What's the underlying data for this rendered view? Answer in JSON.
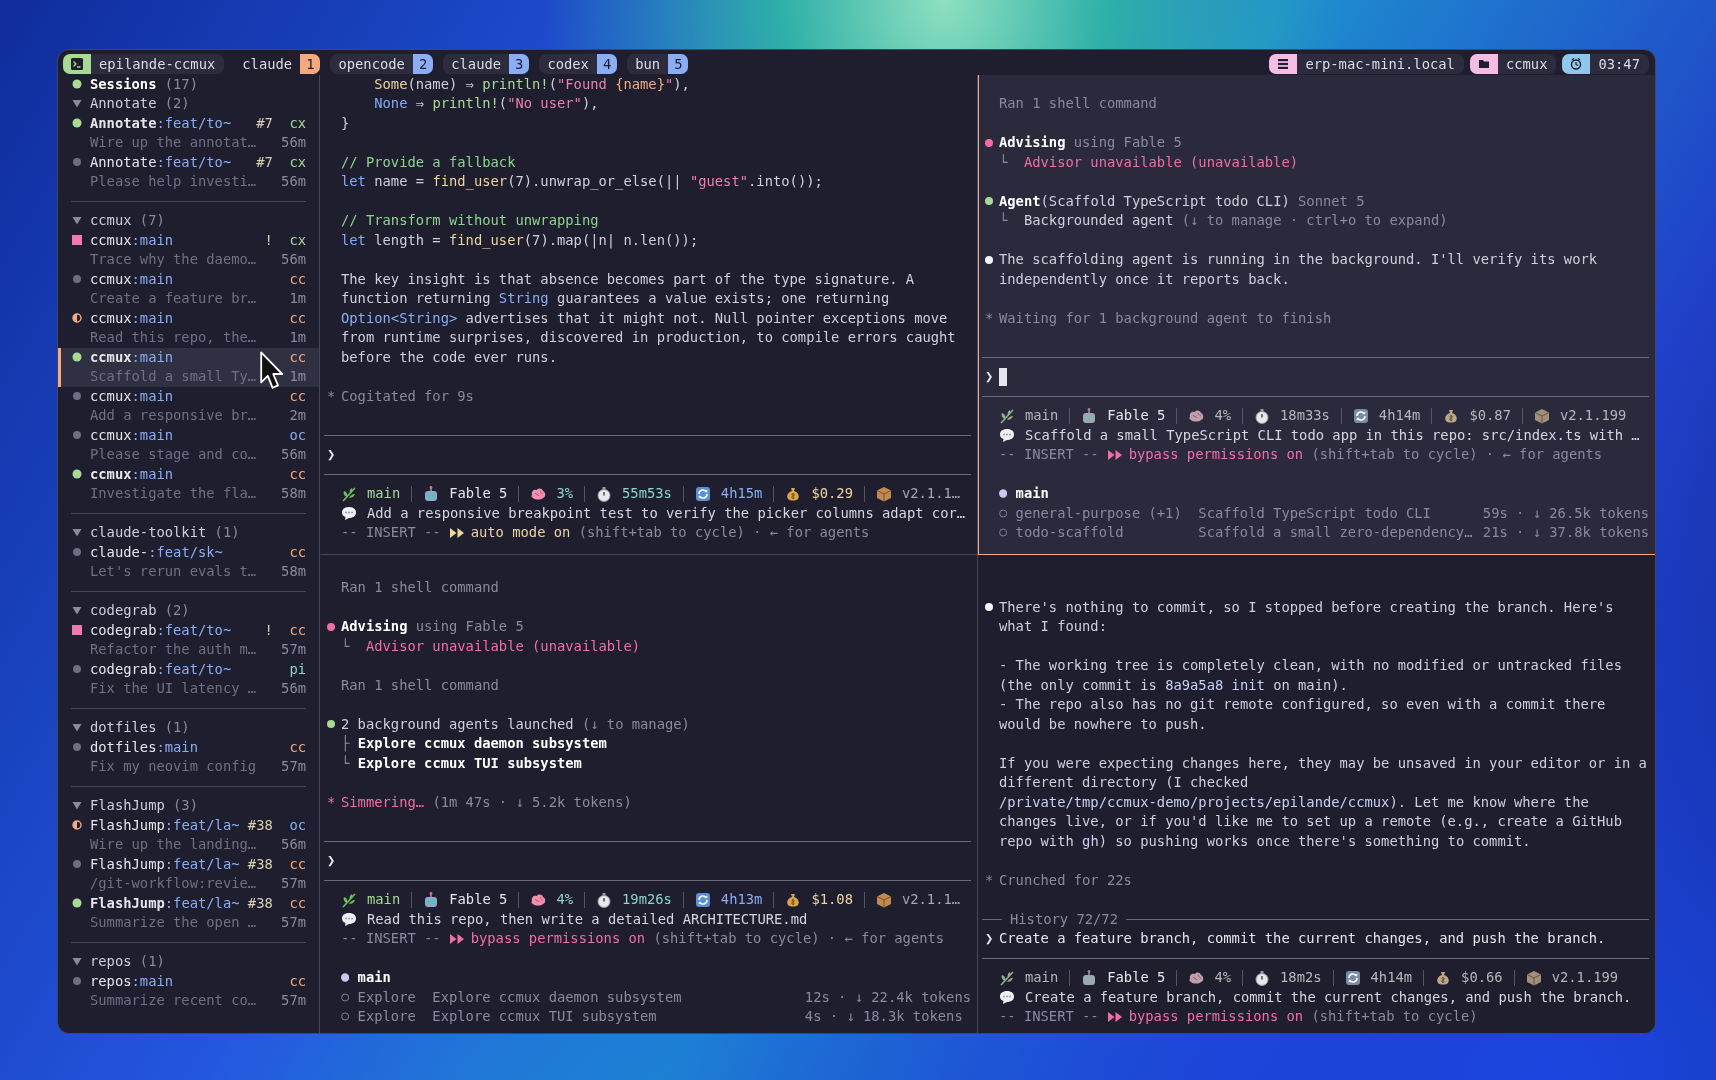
{
  "top_bar": {
    "session": {
      "label": "epilande-ccmux"
    },
    "windows": [
      {
        "name": "claude",
        "number": "1",
        "selected": true
      },
      {
        "name": "opencode",
        "number": "2",
        "selected": false
      },
      {
        "name": "claude",
        "number": "3",
        "selected": false
      },
      {
        "name": "codex",
        "number": "4",
        "selected": false
      },
      {
        "name": "bun",
        "number": "5",
        "selected": false
      }
    ],
    "indicators": [
      {
        "kind": "host",
        "label": "erp-mac-mini.local"
      },
      {
        "kind": "folder",
        "label": "ccmux"
      },
      {
        "kind": "clock",
        "label": "03:47"
      }
    ]
  },
  "sidebar": {
    "title": "Sessions",
    "count": "(17)",
    "groups": [
      {
        "name": "Annotate",
        "count": "(2)",
        "expanded": true,
        "sessions": [
          {
            "kind": "running",
            "repo": "Annotate",
            "branch": ":feat/to~",
            "flag": "#7",
            "agent": {
              "label": "cx",
              "color": "#a6da95"
            },
            "summary": "Wire up the annotat…",
            "age": "56m",
            "selected": false
          },
          {
            "kind": "idle",
            "repo": "Annotate",
            "branch": ":feat/to~",
            "flag": "#7",
            "agent": {
              "label": "cx",
              "color": "#a6da95"
            },
            "summary": "Please help investi…",
            "age": "56m",
            "selected": false
          }
        ]
      },
      {
        "name": "ccmux",
        "count": "(7)",
        "expanded": true,
        "sessions": [
          {
            "kind": "attention",
            "repo": "ccmux",
            "branch": ":main",
            "flag": "!",
            "agent": {
              "label": "cx",
              "color": "#a6da95"
            },
            "summary": "Trace why the daemo…",
            "age": "56m",
            "selected": false
          },
          {
            "kind": "idle",
            "repo": "ccmux",
            "branch": ":main",
            "agent": {
              "label": "cc",
              "color": "#f5a97f"
            },
            "summary": "Create a feature br…",
            "age": "1m",
            "selected": false
          },
          {
            "kind": "waiting",
            "repo": "ccmux",
            "branch": ":main",
            "agent": {
              "label": "cc",
              "color": "#f5a97f"
            },
            "summary": "Read this repo, the…",
            "age": "1m",
            "selected": false
          },
          {
            "kind": "running",
            "repo": "ccmux",
            "branch": ":main",
            "agent": {
              "label": "cc",
              "color": "#f5a97f"
            },
            "summary": "Scaffold a small Ty…",
            "age": "1m",
            "selected": true
          },
          {
            "kind": "idle",
            "repo": "ccmux",
            "branch": ":main",
            "agent": {
              "label": "cc",
              "color": "#f5a97f"
            },
            "summary": "Add a responsive br…",
            "age": "2m",
            "selected": false
          },
          {
            "kind": "idle",
            "repo": "ccmux",
            "branch": ":main",
            "agent": {
              "label": "oc",
              "color": "#8aadf4"
            },
            "summary": "Please stage and co…",
            "age": "56m",
            "selected": false
          },
          {
            "kind": "running",
            "repo": "ccmux",
            "branch": ":main",
            "agent": {
              "label": "cc",
              "color": "#f5a97f"
            },
            "summary": "Investigate the fla…",
            "age": "58m",
            "selected": false
          }
        ]
      },
      {
        "name": "claude-toolkit",
        "count": "(1)",
        "expanded": true,
        "sessions": [
          {
            "kind": "idle",
            "repo": "claude-",
            "branch": ":feat/sk~",
            "agent": {
              "label": "cc",
              "color": "#f5a97f"
            },
            "summary": "Let's rerun evals t…",
            "age": "58m",
            "selected": false
          }
        ]
      },
      {
        "name": "codegrab",
        "count": "(2)",
        "expanded": true,
        "sessions": [
          {
            "kind": "attention",
            "repo": "codegrab",
            "branch": ":feat/to~",
            "flag": "!",
            "agent": {
              "label": "cc",
              "color": "#f5a97f"
            },
            "summary": "Refactor the auth m…",
            "age": "57m",
            "selected": false
          },
          {
            "kind": "idle",
            "repo": "codegrab",
            "branch": ":feat/to~",
            "agent": {
              "label": "pi",
              "color": "#8bd5ca"
            },
            "summary": "Fix the UI latency …",
            "age": "56m",
            "selected": false
          }
        ]
      },
      {
        "name": "dotfiles",
        "count": "(1)",
        "expanded": true,
        "sessions": [
          {
            "kind": "idle",
            "repo": "dotfiles",
            "branch": ":main",
            "agent": {
              "label": "cc",
              "color": "#f5a97f"
            },
            "summary": "Fix my neovim config",
            "age": "57m",
            "selected": false
          }
        ]
      },
      {
        "name": "FlashJump",
        "count": "(3)",
        "expanded": true,
        "sessions": [
          {
            "kind": "waiting",
            "repo": "FlashJump",
            "branch": ":feat/la~",
            "flag": "#38",
            "agent": {
              "label": "oc",
              "color": "#8aadf4"
            },
            "summary": "Wire up the landing…",
            "age": "56m",
            "selected": false
          },
          {
            "kind": "idle",
            "repo": "FlashJump",
            "branch": ":feat/la~",
            "flag": "#38",
            "agent": {
              "label": "cc",
              "color": "#f5a97f"
            },
            "summary": "/git-workflow:revie…",
            "age": "57m",
            "selected": false
          },
          {
            "kind": "running",
            "repo": "FlashJump",
            "branch": ":feat/la~",
            "flag": "#38",
            "agent": {
              "label": "cc",
              "color": "#f5a97f"
            },
            "summary": "Summarize the open …",
            "age": "57m",
            "selected": false
          }
        ]
      },
      {
        "name": "repos",
        "count": "(1)",
        "expanded": true,
        "sessions": [
          {
            "kind": "idle",
            "repo": "repos",
            "branch": ":main",
            "agent": {
              "label": "cc",
              "color": "#f5a97f"
            },
            "summary": "Summarize recent co…",
            "age": "57m",
            "selected": false
          }
        ]
      }
    ]
  },
  "panes": [
    {
      "focused": false,
      "transcript": [
        {
          "kind": "code",
          "lines": [
            [
              {
                "text": "    Some",
                "kind": "accent"
              },
              {
                "text": "(name) ⇒ ",
                "kind": "plain"
              },
              {
                "text": "println!",
                "kind": "function"
              },
              {
                "text": "(",
                "kind": "plain"
              },
              {
                "text": "\"Found ",
                "kind": "string"
              },
              {
                "text": "{name}",
                "kind": "orange"
              },
              {
                "text": "\"",
                "kind": "string"
              },
              {
                "text": "),",
                "kind": "plain"
              }
            ],
            [
              {
                "text": "    None",
                "kind": "keyword"
              },
              {
                "text": " ⇒ ",
                "kind": "plain"
              },
              {
                "text": "println!",
                "kind": "function"
              },
              {
                "text": "(",
                "kind": "plain"
              },
              {
                "text": "\"No user\"",
                "kind": "string"
              },
              {
                "text": "),",
                "kind": "plain"
              }
            ],
            [
              {
                "text": "}",
                "kind": "plain"
              }
            ]
          ]
        },
        {
          "kind": "blank"
        },
        {
          "kind": "code",
          "lines": [
            [
              {
                "text": "// Provide a fallback",
                "kind": "comment"
              }
            ],
            [
              {
                "text": "let",
                "kind": "keyword"
              },
              {
                "text": " name = ",
                "kind": "plain"
              },
              {
                "text": "find_user",
                "kind": "accent"
              },
              {
                "text": "(7).unwrap_or_else(|| ",
                "kind": "plain"
              },
              {
                "text": "\"guest\"",
                "kind": "string"
              },
              {
                "text": ".into());",
                "kind": "plain"
              }
            ]
          ]
        },
        {
          "kind": "blank"
        },
        {
          "kind": "code",
          "lines": [
            [
              {
                "text": "// Transform without unwrapping",
                "kind": "comment"
              }
            ],
            [
              {
                "text": "let",
                "kind": "keyword"
              },
              {
                "text": " length = ",
                "kind": "plain"
              },
              {
                "text": "find_user",
                "kind": "accent"
              },
              {
                "text": "(7).map(|n| n.len());",
                "kind": "plain"
              }
            ]
          ]
        },
        {
          "kind": "blank"
        },
        {
          "kind": "para",
          "lines": [
            [
              {
                "text": "The key insight is that absence becomes part of the type signature. A",
                "kind": "plain"
              }
            ],
            [
              {
                "text": "function returning ",
                "kind": "plain"
              },
              {
                "text": "String",
                "kind": "type"
              },
              {
                "text": " guarantees a value exists; one returning",
                "kind": "plain"
              }
            ],
            [
              {
                "text": "Option<String>",
                "kind": "type"
              },
              {
                "text": " advertises that it might not. Null pointer exceptions move",
                "kind": "plain"
              }
            ],
            [
              {
                "text": "from runtime surprises, discovered in production, to compile errors caught",
                "kind": "plain"
              }
            ],
            [
              {
                "text": "before the code ever runs.",
                "kind": "plain"
              }
            ]
          ]
        },
        {
          "kind": "blank"
        },
        {
          "kind": "para",
          "mark": {
            "text": "*",
            "kind": "dim"
          },
          "lines": [
            [
              {
                "text": "Cogitated for 9s",
                "kind": "dim"
              }
            ]
          ]
        },
        {
          "kind": "blank"
        }
      ],
      "prompt": {
        "symbol": "❯",
        "cursor": false
      },
      "status": {
        "muted": false,
        "items": [
          {
            "kind": "branch",
            "text": "main"
          },
          {
            "kind": "model",
            "text": "Fable 5"
          },
          {
            "kind": "context",
            "text": "3%"
          },
          {
            "kind": "elapsed",
            "text": "55m53s"
          },
          {
            "kind": "session",
            "text": "4h15m"
          },
          {
            "kind": "cost",
            "text": "$0.29"
          },
          {
            "kind": "version",
            "text": "v2.1.1…"
          }
        ],
        "message": "Add a responsive breakpoint test to verify the picker columns adapt cor…",
        "mode_prefix": "-- INSERT --",
        "mode": {
          "kind": "auto",
          "label": "auto mode on"
        },
        "mode_hint": "(shift+tab to cycle)",
        "agents_hint": "· ← for agents"
      }
    },
    {
      "focused": true,
      "transcript": [
        {
          "kind": "blank"
        },
        {
          "kind": "para",
          "lines": [
            [
              {
                "text": "Ran 1 shell command",
                "kind": "dim"
              }
            ]
          ]
        },
        {
          "kind": "blank"
        },
        {
          "kind": "para",
          "color": "#ee6fa6",
          "lines": [
            [
              {
                "text": "Advising",
                "kind": "bold"
              },
              {
                "text": " using Fable 5",
                "kind": "dim"
              }
            ],
            [
              {
                "text": "└  ",
                "kind": "dim"
              },
              {
                "text": "Advisor unavailable (unavailable)",
                "kind": "alert"
              }
            ]
          ]
        },
        {
          "kind": "blank"
        },
        {
          "kind": "para",
          "color": "#a6da95",
          "lines": [
            [
              {
                "text": "Agent",
                "kind": "bold"
              },
              {
                "text": "(Scaffold TypeScript todo CLI)",
                "kind": "plain"
              },
              {
                "text": " Sonnet 5",
                "kind": "dim"
              }
            ],
            [
              {
                "text": "└  ",
                "kind": "dim"
              },
              {
                "text": "Backgrounded agent",
                "kind": "plain"
              },
              {
                "text": " (↓ to manage · ctrl+o to expand)",
                "kind": "dim"
              }
            ]
          ]
        },
        {
          "kind": "blank"
        },
        {
          "kind": "para",
          "color": "#f4f4fa",
          "lines": [
            [
              {
                "text": "The scaffolding agent is running in the background. I'll verify its work",
                "kind": "plain"
              }
            ],
            [
              {
                "text": "independently once it reports back.",
                "kind": "plain"
              }
            ]
          ]
        },
        {
          "kind": "blank"
        },
        {
          "kind": "para",
          "mark": {
            "text": "*",
            "kind": "dim"
          },
          "lines": [
            [
              {
                "text": "Waiting for 1 background agent to finish",
                "kind": "dim"
              }
            ]
          ]
        },
        {
          "kind": "blank"
        }
      ],
      "prompt": {
        "symbol": "❯",
        "cursor": true
      },
      "status": {
        "muted": true,
        "items": [
          {
            "kind": "branch",
            "text": "main"
          },
          {
            "kind": "model",
            "text": "Fable 5"
          },
          {
            "kind": "context",
            "text": "4%"
          },
          {
            "kind": "elapsed",
            "text": "18m33s"
          },
          {
            "kind": "session",
            "text": "4h14m"
          },
          {
            "kind": "cost",
            "text": "$0.87"
          },
          {
            "kind": "version",
            "text": "v2.1.199"
          }
        ],
        "message": "Scaffold a small TypeScript CLI todo app in this repo: src/index.ts with …",
        "mode_prefix": "-- INSERT --",
        "mode": {
          "kind": "bypass",
          "label": "bypass permissions on"
        },
        "mode_hint": "(shift+tab to cycle)",
        "agents_hint": "· ← for agents"
      },
      "agents": {
        "title": "main",
        "rows": [
          {
            "name": "general-purpose (+1)",
            "task": "Scaffold TypeScript todo CLI",
            "stats": "59s · ↓ 26.5k tokens"
          },
          {
            "name": "todo-scaffold",
            "task": "Scaffold a small zero-dependency…",
            "stats": "21s · ↓ 37.8k tokens"
          }
        ]
      }
    },
    {
      "focused": false,
      "transcript": [
        {
          "kind": "blank"
        },
        {
          "kind": "para",
          "lines": [
            [
              {
                "text": "Ran 1 shell command",
                "kind": "dim"
              }
            ]
          ]
        },
        {
          "kind": "blank"
        },
        {
          "kind": "para",
          "color": "#ee6fa6",
          "lines": [
            [
              {
                "text": "Advising",
                "kind": "bold"
              },
              {
                "text": " using Fable 5",
                "kind": "dim"
              }
            ],
            [
              {
                "text": "└  ",
                "kind": "dim"
              },
              {
                "text": "Advisor unavailable (unavailable)",
                "kind": "alert"
              }
            ]
          ]
        },
        {
          "kind": "blank"
        },
        {
          "kind": "para",
          "lines": [
            [
              {
                "text": "Ran 1 shell command",
                "kind": "dim"
              }
            ]
          ]
        },
        {
          "kind": "blank"
        },
        {
          "kind": "para",
          "color": "#a6da95",
          "lines": [
            [
              {
                "text": "2 background agents launched",
                "kind": "plain"
              },
              {
                "text": " (↓ to manage)",
                "kind": "dim"
              }
            ],
            [
              {
                "text": "├ ",
                "kind": "dim"
              },
              {
                "text": "Explore ccmux daemon subsystem",
                "kind": "bold"
              }
            ],
            [
              {
                "text": "└ ",
                "kind": "dim"
              },
              {
                "text": "Explore ccmux TUI subsystem",
                "kind": "bold"
              }
            ]
          ]
        },
        {
          "kind": "blank"
        },
        {
          "kind": "para",
          "mark": {
            "text": "*",
            "kind": "alert"
          },
          "lines": [
            [
              {
                "text": "Simmering…",
                "kind": "alert"
              },
              {
                "text": " (1m 47s · ↓ 5.2k tokens)",
                "kind": "dim"
              }
            ]
          ]
        },
        {
          "kind": "blank"
        }
      ],
      "prompt": {
        "symbol": "❯",
        "cursor": false
      },
      "status": {
        "muted": false,
        "items": [
          {
            "kind": "branch",
            "text": "main"
          },
          {
            "kind": "model",
            "text": "Fable 5"
          },
          {
            "kind": "context",
            "text": "4%"
          },
          {
            "kind": "elapsed",
            "text": "19m26s"
          },
          {
            "kind": "session",
            "text": "4h13m"
          },
          {
            "kind": "cost",
            "text": "$1.08"
          },
          {
            "kind": "version",
            "text": "v2.1.1…"
          }
        ],
        "message": "Read this repo, then write a detailed ARCHITECTURE.md",
        "mode_prefix": "-- INSERT --",
        "mode": {
          "kind": "bypass",
          "label": "bypass permissions on"
        },
        "mode_hint": "(shift+tab to cycle)",
        "agents_hint": "· ← for agents"
      },
      "agents": {
        "title": "main",
        "rows": [
          {
            "name": "Explore",
            "task": "Explore ccmux daemon subsystem",
            "stats": "12s · ↓ 22.4k tokens"
          },
          {
            "name": "Explore",
            "task": "Explore ccmux TUI subsystem",
            "stats": "4s · ↓ 18.3k tokens"
          }
        ]
      }
    },
    {
      "focused": false,
      "transcript": [
        {
          "kind": "blank"
        },
        {
          "kind": "blank"
        },
        {
          "kind": "para",
          "color": "#f4f4fa",
          "lines": [
            [
              {
                "text": "There's nothing to commit, so I stopped before creating the branch. Here's",
                "kind": "plain"
              }
            ],
            [
              {
                "text": "what I found:",
                "kind": "plain"
              }
            ]
          ]
        },
        {
          "kind": "blank"
        },
        {
          "kind": "para",
          "lines": [
            [
              {
                "text": "- The working tree is completely clean, with no modified or untracked files",
                "kind": "plain"
              }
            ],
            [
              {
                "text": "(the only commit is ",
                "kind": "plain"
              },
              {
                "text": "8a9a5a8 init",
                "kind": "path"
              },
              {
                "text": " on main).",
                "kind": "plain"
              }
            ],
            [
              {
                "text": "- The repo also has no git remote configured, so even with a commit there",
                "kind": "plain"
              }
            ],
            [
              {
                "text": "would be nowhere to push.",
                "kind": "plain"
              }
            ]
          ]
        },
        {
          "kind": "blank"
        },
        {
          "kind": "para",
          "lines": [
            [
              {
                "text": "If you were expecting changes here, they may be unsaved in your editor or in a",
                "kind": "plain"
              }
            ],
            [
              {
                "text": "different directory (I checked",
                "kind": "plain"
              }
            ],
            [
              {
                "text": "/private/tmp/ccmux-demo/projects/epilande/ccmux",
                "kind": "path"
              },
              {
                "text": "). Let me know where the",
                "kind": "plain"
              }
            ],
            [
              {
                "text": "changes live, or if you'd like me to set up a remote (e.g., create a GitHub",
                "kind": "plain"
              }
            ],
            [
              {
                "text": "repo with ",
                "kind": "plain"
              },
              {
                "text": "gh",
                "kind": "path"
              },
              {
                "text": ") so pushing works once there's something to commit.",
                "kind": "plain"
              }
            ]
          ]
        },
        {
          "kind": "blank"
        },
        {
          "kind": "para",
          "mark": {
            "text": "*",
            "kind": "dim"
          },
          "lines": [
            [
              {
                "text": "Crunched for 22s",
                "kind": "dim"
              }
            ]
          ]
        },
        {
          "kind": "blank"
        }
      ],
      "prompt": {
        "symbol": "❯",
        "cursor": false,
        "history": "History 72/72",
        "text": "Create a feature branch, commit the current changes, and push the branch."
      },
      "status": {
        "muted": true,
        "items": [
          {
            "kind": "branch",
            "text": "main"
          },
          {
            "kind": "model",
            "text": "Fable 5"
          },
          {
            "kind": "context",
            "text": "4%"
          },
          {
            "kind": "elapsed",
            "text": "18m2s"
          },
          {
            "kind": "session",
            "text": "4h14m"
          },
          {
            "kind": "cost",
            "text": "$0.66"
          },
          {
            "kind": "version",
            "text": "v2.1.199"
          }
        ],
        "message": "Create a feature branch, commit the current changes, and push the branch.",
        "mode_prefix": "-- INSERT --",
        "mode": {
          "kind": "bypass",
          "label": "bypass permissions on"
        },
        "mode_hint": "(shift+tab to cycle)"
      }
    }
  ]
}
